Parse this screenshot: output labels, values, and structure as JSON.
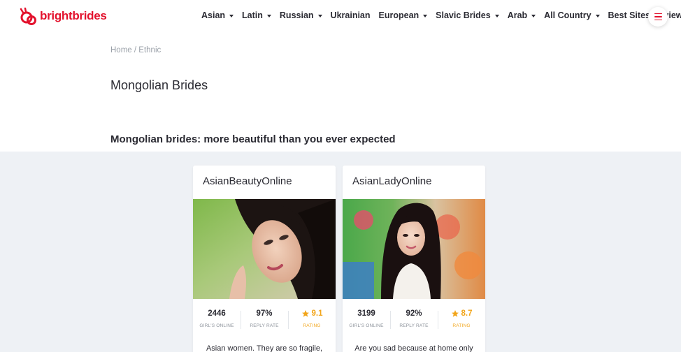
{
  "brand": {
    "name": "brightbrides",
    "color": "#e3122d"
  },
  "nav": {
    "items": [
      {
        "label": "Asian",
        "dropdown": true
      },
      {
        "label": "Latin",
        "dropdown": true
      },
      {
        "label": "Russian",
        "dropdown": true
      },
      {
        "label": "Ukrainian",
        "dropdown": false
      },
      {
        "label": "European",
        "dropdown": true
      },
      {
        "label": "Slavic Brides",
        "dropdown": true
      },
      {
        "label": "Arab",
        "dropdown": true
      },
      {
        "label": "All Country",
        "dropdown": true
      },
      {
        "label": "Best Sites Reviews",
        "dropdown": true
      }
    ],
    "menu_icon": "hamburger-icon"
  },
  "breadcrumb": {
    "home": "Home",
    "separator": " / ",
    "current": "Ethnic"
  },
  "page": {
    "title": "Mongolian Brides",
    "subtitle": "Mongolian brides: more beautiful than you ever expected"
  },
  "cards": [
    {
      "name": "AsianBeautyOnline",
      "girls_online": "2446",
      "girls_online_label": "GIRL'S ONLINE",
      "reply_rate": "97%",
      "reply_rate_label": "REPLY RATE",
      "rating": "9.1",
      "rating_label": "RATING",
      "description": "Asian women. They are so fragile,"
    },
    {
      "name": "AsianLadyOnline",
      "girls_online": "3199",
      "girls_online_label": "GIRL'S ONLINE",
      "reply_rate": "92%",
      "reply_rate_label": "REPLY RATE",
      "rating": "8.7",
      "rating_label": "RATING",
      "description": "Are you sad because at home only"
    }
  ],
  "colors": {
    "accent": "#e3122d",
    "rating": "#f2a51a",
    "band": "#eef1f5"
  }
}
